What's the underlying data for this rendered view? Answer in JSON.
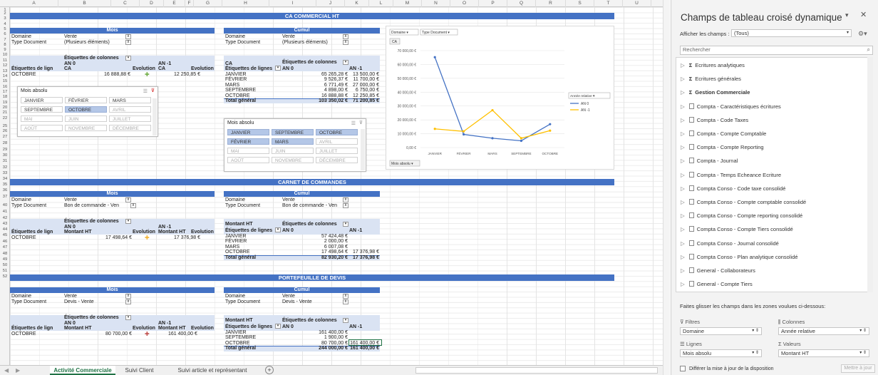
{
  "sheet": {
    "columns": [
      "A",
      "B",
      "C",
      "D",
      "E",
      "F",
      "G",
      "H",
      "I",
      "J",
      "K",
      "L",
      "M",
      "N",
      "O",
      "P",
      "Q",
      "R",
      "S",
      "T",
      "U"
    ],
    "rows": [
      "1",
      "2",
      "3",
      "4",
      "5",
      "6",
      "7",
      "8",
      "9",
      "10",
      "11",
      "12",
      "13",
      "14",
      "15",
      "16",
      "17",
      "18",
      "19",
      "20",
      "21",
      "22",
      "25",
      "26",
      "27",
      "28",
      "29",
      "30",
      "31",
      "32",
      "33",
      "34",
      "35",
      "36",
      "37",
      "40",
      "41",
      "42",
      "43",
      "44",
      "45",
      "46",
      "47",
      "48",
      "49",
      "50",
      "51",
      "52"
    ],
    "section1": {
      "title": "CA COMMERCIAL HT"
    },
    "section2": {
      "title": "CARNET DE COMMANDES"
    },
    "section3": {
      "title": "PORTEFEUILLE DE DEVIS"
    },
    "p1": {
      "hdr": "Mois",
      "dom_l": "Domaine",
      "dom_v": "Vente",
      "type_l": "Type Document",
      "type_v": "(Plusieurs éléments)",
      "etiq": "Étiquettes de colonnes",
      "an0": "AN 0",
      "an1": "AN -1",
      "etiq_l": "Étiquettes de lign",
      "ca": "CA",
      "evol": "Evolution",
      "ca2": "CA",
      "evol2": "Evolution",
      "row": "OCTOBRE",
      "v1": "16 888,88 €",
      "v2": "12 250,85 €"
    },
    "p2": {
      "hdr": "Cumul",
      "dom_l": "Domaine",
      "dom_v": "Vente",
      "type_l": "Type Document",
      "type_v": "(Plusieurs éléments)",
      "ca": "CA",
      "etiq": "Étiquettes de colonnes",
      "etiq_l": "Étiquettes de lignes",
      "an0": "AN 0",
      "an1": "AN -1",
      "rows": [
        [
          "JANVIER",
          "65 265,28 €",
          "13 500,00 €"
        ],
        [
          "FÉVRIER",
          "9 526,37 €",
          "11 700,00 €"
        ],
        [
          "MARS",
          "6 771,49 €",
          "27 000,00 €"
        ],
        [
          "SEPTEMBRE",
          "4 898,00 €",
          "6 750,00 €"
        ],
        [
          "OCTOBRE",
          "16 888,88 €",
          "12 250,85 €"
        ]
      ],
      "total": [
        "Total général",
        "103 350,02 €",
        "71 200,85 €"
      ]
    },
    "p3": {
      "hdr": "Mois",
      "dom_l": "Domaine",
      "dom_v": "Vente",
      "type_l": "Type Document",
      "type_v": "Bon de commande - Ven",
      "etiq": "Étiquettes de colonnes",
      "an0": "AN 0",
      "an1": "AN -1",
      "etiq_l": "Étiquettes de lign",
      "mht": "Montant HT",
      "evol": "Evolution",
      "mht2": "Montant HT",
      "evol2": "Evolution",
      "row": "OCTOBRE",
      "v1": "17 498,64 €",
      "v2": "17 376,98 €"
    },
    "p4": {
      "hdr": "Cumul",
      "dom_l": "Domaine",
      "dom_v": "Vente",
      "type_l": "Type Document",
      "type_v": "Bon de commande - Ven",
      "mht": "Montant HT",
      "etiq": "Étiquettes de colonnes",
      "etiq_l": "Étiquettes de lignes",
      "an0": "AN 0",
      "an1": "AN -1",
      "rows": [
        [
          "JANVIER",
          "57 424,48 €",
          ""
        ],
        [
          "FÉVRIER",
          "2 000,00 €",
          ""
        ],
        [
          "MARS",
          "6 007,08 €",
          ""
        ],
        [
          "OCTOBRE",
          "17 498,64 €",
          "17 376,98 €"
        ]
      ],
      "total": [
        "Total général",
        "82 930,20 €",
        "17 376,98 €"
      ]
    },
    "p5": {
      "hdr": "Mois",
      "dom_l": "Domaine",
      "dom_v": "Vente",
      "type_l": "Type Document",
      "type_v": "Devis - Vente",
      "etiq": "Étiquettes de colonnes",
      "an0": "AN 0",
      "an1": "AN -1",
      "etiq_l": "Étiquettes de lign",
      "mht": "Montant HT",
      "evol": "Evolution",
      "mht2": "Montant HT",
      "evol2": "Evolution",
      "row": "OCTOBRE",
      "v1": "80 700,00 €",
      "v2": "161 400,00 €"
    },
    "p6": {
      "hdr": "Cumul",
      "dom_l": "Domaine",
      "dom_v": "Vente",
      "type_l": "Type Document",
      "type_v": "Devis - Vente",
      "mht": "Montant HT",
      "etiq": "Étiquettes de colonnes",
      "etiq_l": "Étiquettes de lignes",
      "an0": "AN 0",
      "an1": "AN -1",
      "rows": [
        [
          "JANVIER",
          "161 400,00 €",
          ""
        ],
        [
          "SEPTEMBRE",
          "1 900,00 €",
          ""
        ],
        [
          "OCTOBRE",
          "80 700,00 €",
          "161 400,00 €"
        ]
      ],
      "total": [
        "Total général",
        "244 000,00 €",
        "161 400,00 €"
      ]
    },
    "slicer1": {
      "title": "Mois absolu",
      "items": [
        "JANVIER",
        "FÉVRIER",
        "MARS",
        "SEPTEMBRE",
        "OCTOBRE",
        "AVRIL",
        "MAI",
        "JUIN",
        "JUILLET",
        "AOÛT",
        "NOVEMBRE",
        "DÉCEMBRE"
      ],
      "selected": [
        "OCTOBRE"
      ],
      "active": [
        "JANVIER",
        "FÉVRIER",
        "MARS",
        "SEPTEMBRE",
        "OCTOBRE"
      ]
    },
    "slicer2": {
      "title": "Mois absolu",
      "items": [
        "JANVIER",
        "SEPTEMBRE",
        "OCTOBRE",
        "FÉVRIER",
        "MARS",
        "AVRIL",
        "MAI",
        "JUIN",
        "JUILLET",
        "AOÛT",
        "NOVEMBRE",
        "DÉCEMBRE"
      ],
      "selected": [
        "JANVIER",
        "SEPTEMBRE",
        "OCTOBRE",
        "FÉVRIER",
        "MARS"
      ],
      "active": [
        "JANVIER",
        "SEPTEMBRE",
        "OCTOBRE",
        "FÉVRIER",
        "MARS"
      ]
    },
    "tabs": [
      "Activité Commerciale",
      "Suivi Client",
      "Suivi article et représentant"
    ],
    "active_tab": "Activité Commerciale"
  },
  "chart_data": {
    "type": "line",
    "filter_buttons": [
      "Domaine",
      "Type Document",
      "CA"
    ],
    "categories": [
      "JANVIER",
      "FÉVRIER",
      "MARS",
      "SEPTEMBRE",
      "OCTOBRE"
    ],
    "series": [
      {
        "name": "AN 0",
        "values": [
          65265.28,
          9526.37,
          6771.49,
          4898.0,
          16888.88
        ],
        "color": "#4472c4"
      },
      {
        "name": "AN -1",
        "values": [
          13500.0,
          11700.0,
          27000.0,
          6750.0,
          12250.85
        ],
        "color": "#ffc000"
      }
    ],
    "yticks": [
      "70 000,00 €",
      "60 000,00 €",
      "50 000,00 €",
      "40 000,00 €",
      "30 000,00 €",
      "20 000,00 €",
      "10 000,00 €",
      "0,00 €"
    ],
    "ylim": [
      0,
      70000
    ],
    "legend_title": "Année relative",
    "axis_button": "Mois absolu"
  },
  "panel": {
    "title": "Champs de tableau croisé dynamique",
    "show_label": "Afficher les champs :",
    "show_value": "(Tous)",
    "search_placeholder": "Rechercher",
    "fields": [
      {
        "name": "Ecritures analytiques",
        "sigma": true,
        "bold": false
      },
      {
        "name": "Ecritures générales",
        "sigma": true,
        "bold": false
      },
      {
        "name": "Gestion Commerciale",
        "sigma": true,
        "bold": true
      },
      {
        "name": "Compta - Caractéristiques écritures"
      },
      {
        "name": "Compta - Code Taxes"
      },
      {
        "name": "Compta - Compte Comptable"
      },
      {
        "name": "Compta - Compte Reporting"
      },
      {
        "name": "Compta - Journal"
      },
      {
        "name": "Compta - Temps Echeance Ecriture"
      },
      {
        "name": "Compta Conso - Code taxe consolidé"
      },
      {
        "name": "Compta Conso - Compte comptable consolidé"
      },
      {
        "name": "Compta Conso - Compte reporting consolidé"
      },
      {
        "name": "Compta Conso - Compte Tiers consolidé"
      },
      {
        "name": "Compta Conso - Journal consolidé"
      },
      {
        "name": "Compta Conso - Plan analytique consolidé"
      },
      {
        "name": "General - Collaborateurs"
      },
      {
        "name": "General - Compte Tiers"
      }
    ],
    "drag_hint": "Faites glisser les champs dans les zones voulues ci-dessous:",
    "filters_label": "Filtres",
    "filters_value": "Domaine",
    "columns_label": "Colonnes",
    "columns_value": "Année relative",
    "rows_label": "Lignes",
    "rows_value": "Mois absolu",
    "values_label": "Valeurs",
    "values_value": "Montant HT",
    "defer_label": "Différer la mise à jour de la disposition",
    "update_label": "Mettre à jour"
  }
}
